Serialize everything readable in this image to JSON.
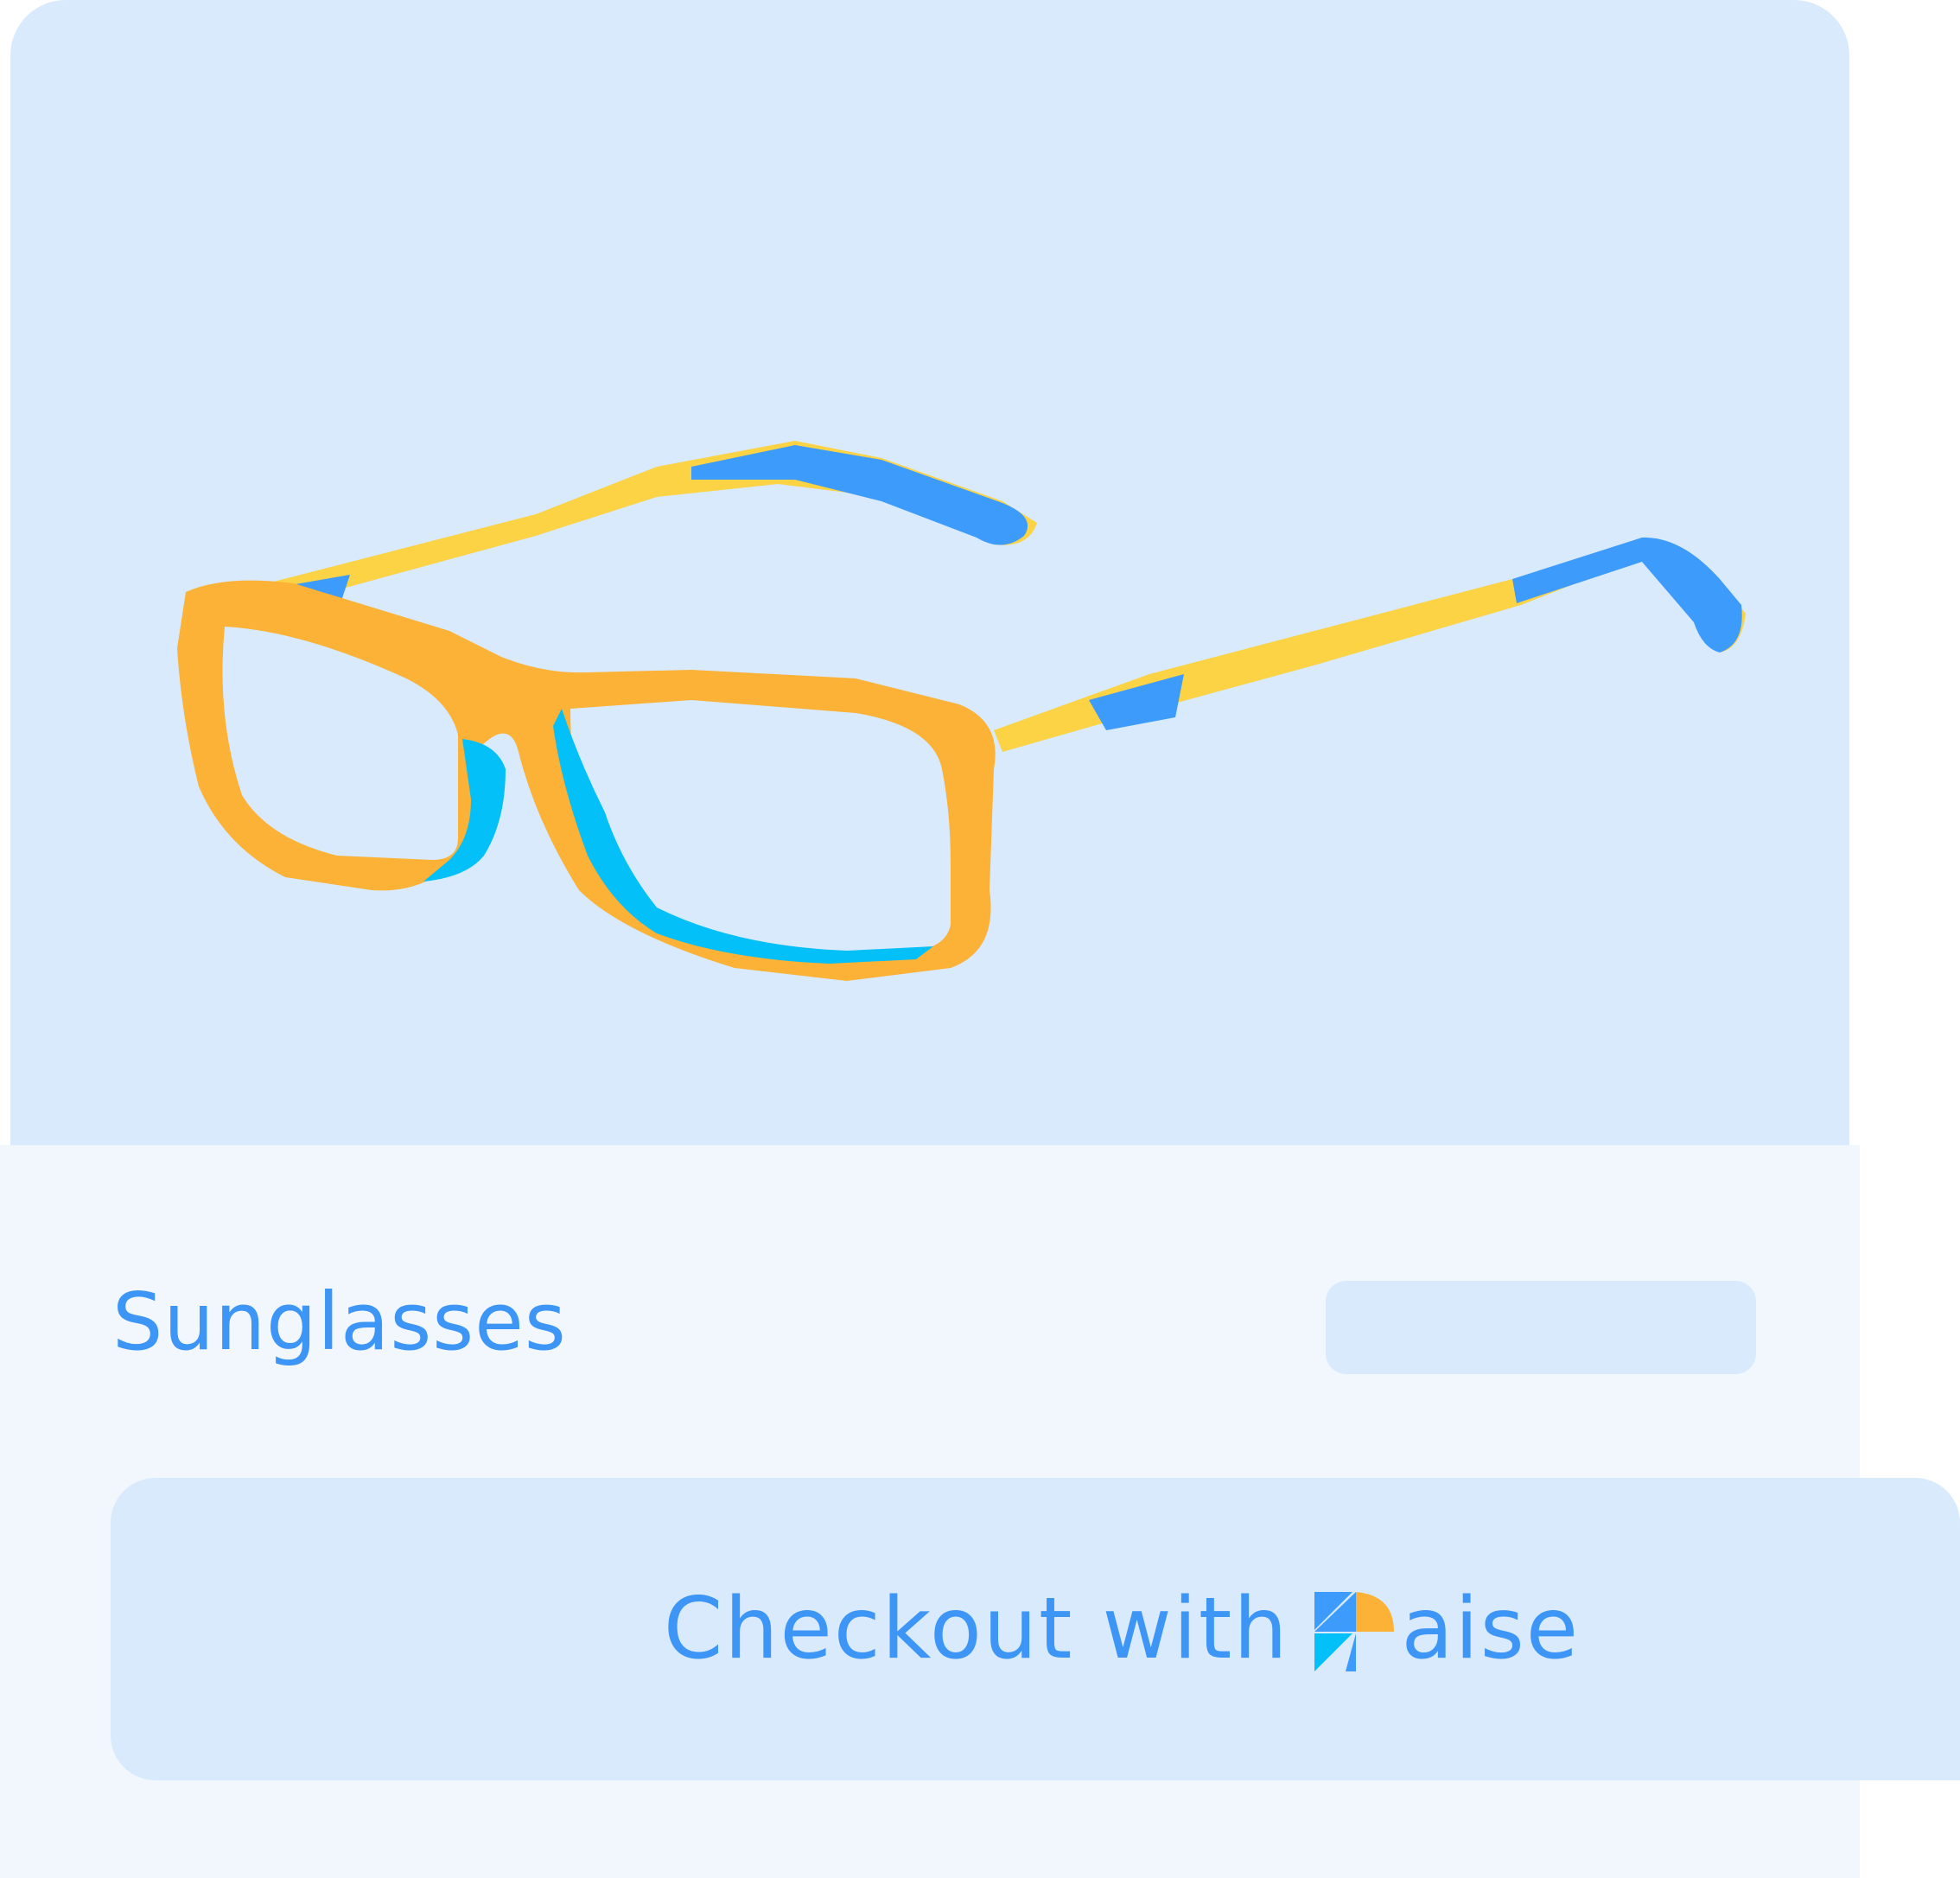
{
  "product": {
    "name": "Sunglasses",
    "image_icon": "eyeglasses-icon"
  },
  "checkout": {
    "label": "Checkout with",
    "brand_text": "aise",
    "brand_icon": "paise-logo-icon"
  },
  "colors": {
    "card_top": "#d8eafc",
    "card_bottom": "#f1f7fd",
    "accent": "#3d96f5",
    "frame_orange": "#fbb236",
    "frame_yellow": "#fbd344",
    "frame_blue": "#3d9bfb",
    "frame_cyan": "#04c0f8"
  }
}
